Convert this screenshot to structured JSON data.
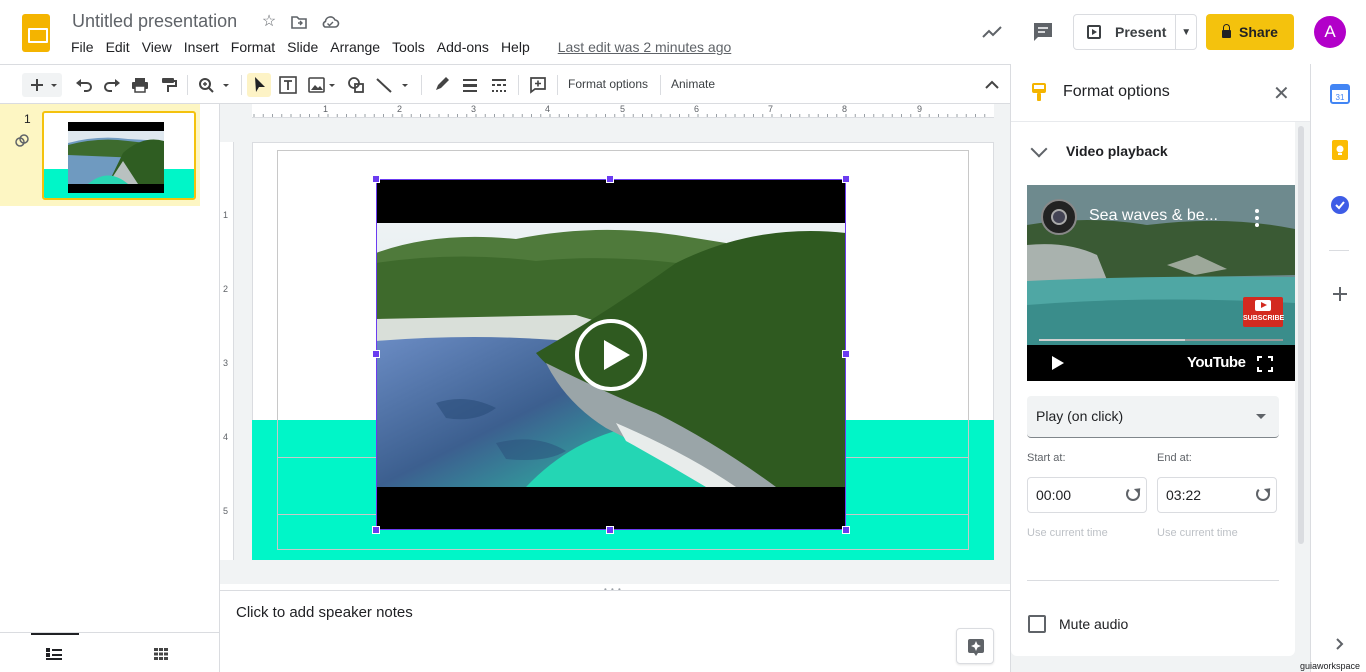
{
  "header": {
    "title": "Untitled presentation",
    "menu": [
      "File",
      "Edit",
      "View",
      "Insert",
      "Format",
      "Slide",
      "Arrange",
      "Tools",
      "Add-ons",
      "Help"
    ],
    "last_edit": "Last edit was 2 minutes ago",
    "present_label": "Present",
    "share_label": "Share",
    "avatar_letter": "A",
    "avatar_color": "#b200c9",
    "brand_color": "#f4b400"
  },
  "toolbar": {
    "format_options": "Format options",
    "animate": "Animate"
  },
  "filmstrip": {
    "slide_number": "1"
  },
  "ruler": {
    "top_numbers": [
      "1",
      "2",
      "3",
      "4",
      "5",
      "6",
      "7",
      "8",
      "9"
    ],
    "left_numbers": [
      "1",
      "2",
      "3",
      "4",
      "5"
    ]
  },
  "notes": {
    "placeholder": "Click to add speaker notes"
  },
  "panel": {
    "title": "Format options",
    "section_title": "Video playback",
    "video_title": "Sea waves & be...",
    "youtube_logo": "YouTube",
    "subscribe": "SUBSCRIBE",
    "play_mode": "Play (on click)",
    "start_label": "Start at:",
    "end_label": "End at:",
    "start_value": "00:00",
    "end_value": "03:22",
    "use_current_time": "Use current time",
    "mute_label": "Mute audio",
    "mute_checked": false
  },
  "watermark": "guiaworkspace",
  "colors": {
    "teal": "#00f6c8",
    "selection": "#6b3cf0",
    "share_bg": "#f4c20d"
  }
}
